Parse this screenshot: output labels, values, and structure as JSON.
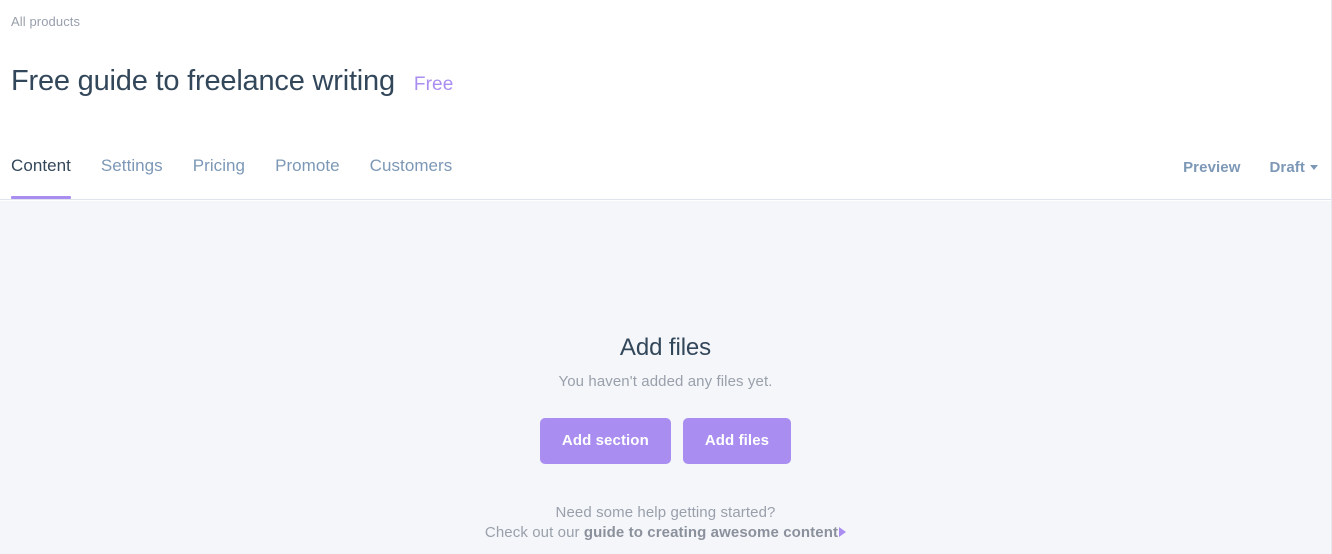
{
  "header": {
    "breadcrumb": "All products",
    "title": "Free guide to freelance writing",
    "price_badge": "Free",
    "tabs": [
      {
        "label": "Content",
        "active": true
      },
      {
        "label": "Settings",
        "active": false
      },
      {
        "label": "Pricing",
        "active": false
      },
      {
        "label": "Promote",
        "active": false
      },
      {
        "label": "Customers",
        "active": false
      }
    ],
    "actions": {
      "preview_label": "Preview",
      "status_label": "Draft"
    }
  },
  "main": {
    "empty_state": {
      "title": "Add files",
      "subtitle": "You haven't added any files yet.",
      "primary_button": "Add section",
      "secondary_button": "Add files",
      "help_line_1": "Need some help getting started?",
      "help_prefix": "Check out our ",
      "help_link": "guide to creating awesome content"
    }
  },
  "colors": {
    "accent_purple": "#a98df0",
    "title_dark": "#33475b",
    "muted_gray": "#99a0ab",
    "tab_inactive": "#7c98b6",
    "content_bg": "#f5f6fa",
    "divider": "#dfe3eb"
  }
}
